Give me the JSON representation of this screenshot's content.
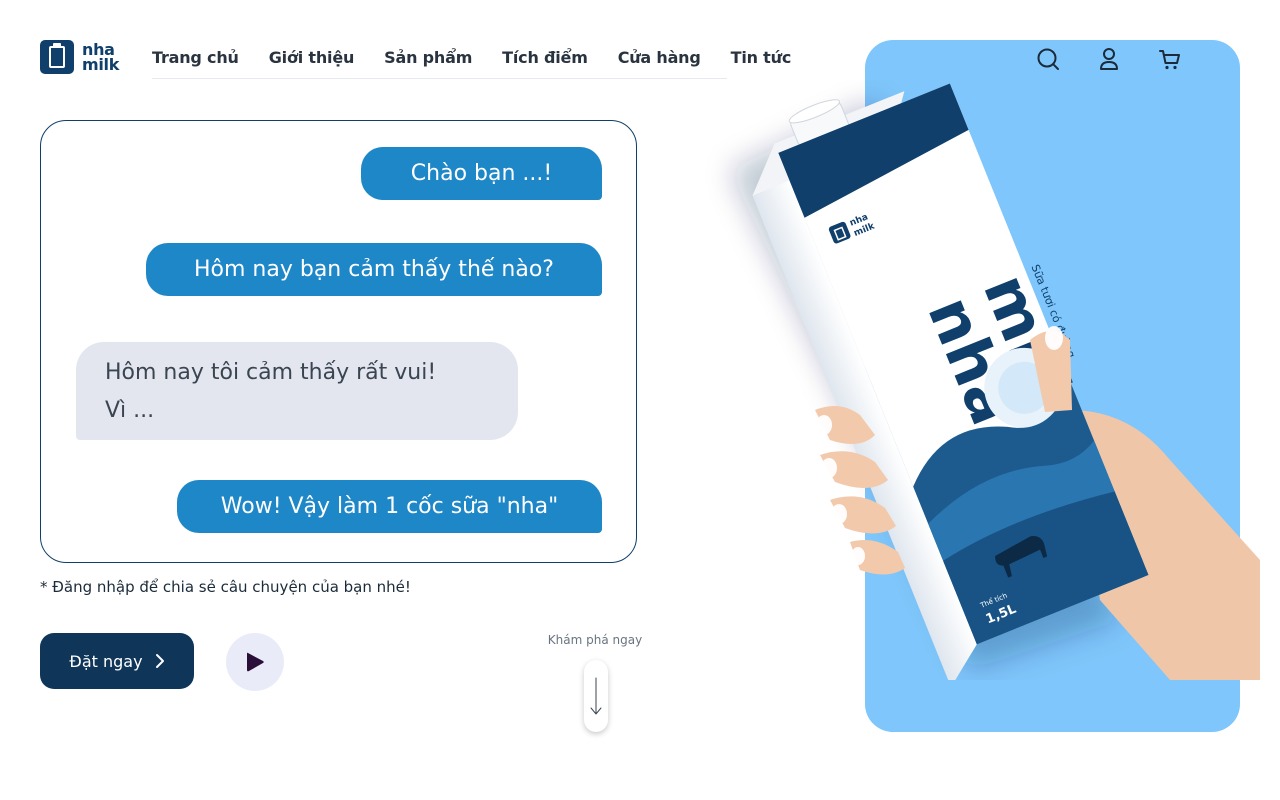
{
  "brand": {
    "logo_line1": "nha",
    "logo_line2": "milk",
    "color": "#0f3f6a"
  },
  "nav": {
    "items": [
      "Trang chủ",
      "Giới thiệu",
      "Sản phẩm",
      "Tích điểm",
      "Cửa hàng",
      "Tin tức"
    ]
  },
  "header_icons": [
    "search-icon",
    "user-icon",
    "cart-icon"
  ],
  "chat": {
    "messages": [
      {
        "from": "brand",
        "text": "Chào bạn ...!"
      },
      {
        "from": "brand",
        "text": "Hôm nay bạn cảm thấy thế nào?"
      },
      {
        "from": "user",
        "line1": "Hôm nay tôi cảm thấy rất vui!",
        "line2": "Vì ..."
      },
      {
        "from": "brand",
        "text": "Wow! Vậy làm 1 cốc sữa \"nha\""
      }
    ],
    "note": "* Đăng nhập để chia sẻ câu chuyện của bạn nhé!"
  },
  "cta": {
    "label": "Đặt ngay",
    "icon": "chevron-right-icon"
  },
  "play": {
    "icon": "play-icon"
  },
  "explore": {
    "label": "Khám phá ngay",
    "icon": "arrow-down-icon"
  },
  "product": {
    "brand_small_1": "nha",
    "brand_small_2": "milk",
    "big_1": "nha",
    "big_2": "milk",
    "tagline": "Sữa tươi có đường",
    "volume_label": "Thể tích",
    "volume": "1,5L"
  },
  "colors": {
    "accent": "#1e87c8",
    "dark": "#0f3559",
    "hero_bg": "#7ec6fb",
    "bubble_in": "#e3e6ef"
  }
}
